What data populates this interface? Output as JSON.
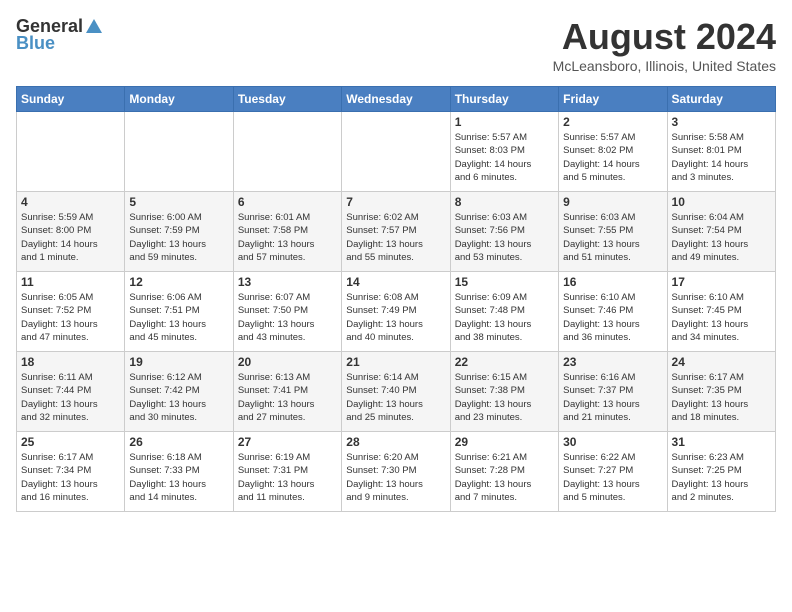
{
  "header": {
    "logo_general": "General",
    "logo_blue": "Blue",
    "month_title": "August 2024",
    "location": "McLeansboro, Illinois, United States"
  },
  "weekdays": [
    "Sunday",
    "Monday",
    "Tuesday",
    "Wednesday",
    "Thursday",
    "Friday",
    "Saturday"
  ],
  "weeks": [
    [
      {
        "day": "",
        "info": ""
      },
      {
        "day": "",
        "info": ""
      },
      {
        "day": "",
        "info": ""
      },
      {
        "day": "",
        "info": ""
      },
      {
        "day": "1",
        "info": "Sunrise: 5:57 AM\nSunset: 8:03 PM\nDaylight: 14 hours\nand 6 minutes."
      },
      {
        "day": "2",
        "info": "Sunrise: 5:57 AM\nSunset: 8:02 PM\nDaylight: 14 hours\nand 5 minutes."
      },
      {
        "day": "3",
        "info": "Sunrise: 5:58 AM\nSunset: 8:01 PM\nDaylight: 14 hours\nand 3 minutes."
      }
    ],
    [
      {
        "day": "4",
        "info": "Sunrise: 5:59 AM\nSunset: 8:00 PM\nDaylight: 14 hours\nand 1 minute."
      },
      {
        "day": "5",
        "info": "Sunrise: 6:00 AM\nSunset: 7:59 PM\nDaylight: 13 hours\nand 59 minutes."
      },
      {
        "day": "6",
        "info": "Sunrise: 6:01 AM\nSunset: 7:58 PM\nDaylight: 13 hours\nand 57 minutes."
      },
      {
        "day": "7",
        "info": "Sunrise: 6:02 AM\nSunset: 7:57 PM\nDaylight: 13 hours\nand 55 minutes."
      },
      {
        "day": "8",
        "info": "Sunrise: 6:03 AM\nSunset: 7:56 PM\nDaylight: 13 hours\nand 53 minutes."
      },
      {
        "day": "9",
        "info": "Sunrise: 6:03 AM\nSunset: 7:55 PM\nDaylight: 13 hours\nand 51 minutes."
      },
      {
        "day": "10",
        "info": "Sunrise: 6:04 AM\nSunset: 7:54 PM\nDaylight: 13 hours\nand 49 minutes."
      }
    ],
    [
      {
        "day": "11",
        "info": "Sunrise: 6:05 AM\nSunset: 7:52 PM\nDaylight: 13 hours\nand 47 minutes."
      },
      {
        "day": "12",
        "info": "Sunrise: 6:06 AM\nSunset: 7:51 PM\nDaylight: 13 hours\nand 45 minutes."
      },
      {
        "day": "13",
        "info": "Sunrise: 6:07 AM\nSunset: 7:50 PM\nDaylight: 13 hours\nand 43 minutes."
      },
      {
        "day": "14",
        "info": "Sunrise: 6:08 AM\nSunset: 7:49 PM\nDaylight: 13 hours\nand 40 minutes."
      },
      {
        "day": "15",
        "info": "Sunrise: 6:09 AM\nSunset: 7:48 PM\nDaylight: 13 hours\nand 38 minutes."
      },
      {
        "day": "16",
        "info": "Sunrise: 6:10 AM\nSunset: 7:46 PM\nDaylight: 13 hours\nand 36 minutes."
      },
      {
        "day": "17",
        "info": "Sunrise: 6:10 AM\nSunset: 7:45 PM\nDaylight: 13 hours\nand 34 minutes."
      }
    ],
    [
      {
        "day": "18",
        "info": "Sunrise: 6:11 AM\nSunset: 7:44 PM\nDaylight: 13 hours\nand 32 minutes."
      },
      {
        "day": "19",
        "info": "Sunrise: 6:12 AM\nSunset: 7:42 PM\nDaylight: 13 hours\nand 30 minutes."
      },
      {
        "day": "20",
        "info": "Sunrise: 6:13 AM\nSunset: 7:41 PM\nDaylight: 13 hours\nand 27 minutes."
      },
      {
        "day": "21",
        "info": "Sunrise: 6:14 AM\nSunset: 7:40 PM\nDaylight: 13 hours\nand 25 minutes."
      },
      {
        "day": "22",
        "info": "Sunrise: 6:15 AM\nSunset: 7:38 PM\nDaylight: 13 hours\nand 23 minutes."
      },
      {
        "day": "23",
        "info": "Sunrise: 6:16 AM\nSunset: 7:37 PM\nDaylight: 13 hours\nand 21 minutes."
      },
      {
        "day": "24",
        "info": "Sunrise: 6:17 AM\nSunset: 7:35 PM\nDaylight: 13 hours\nand 18 minutes."
      }
    ],
    [
      {
        "day": "25",
        "info": "Sunrise: 6:17 AM\nSunset: 7:34 PM\nDaylight: 13 hours\nand 16 minutes."
      },
      {
        "day": "26",
        "info": "Sunrise: 6:18 AM\nSunset: 7:33 PM\nDaylight: 13 hours\nand 14 minutes."
      },
      {
        "day": "27",
        "info": "Sunrise: 6:19 AM\nSunset: 7:31 PM\nDaylight: 13 hours\nand 11 minutes."
      },
      {
        "day": "28",
        "info": "Sunrise: 6:20 AM\nSunset: 7:30 PM\nDaylight: 13 hours\nand 9 minutes."
      },
      {
        "day": "29",
        "info": "Sunrise: 6:21 AM\nSunset: 7:28 PM\nDaylight: 13 hours\nand 7 minutes."
      },
      {
        "day": "30",
        "info": "Sunrise: 6:22 AM\nSunset: 7:27 PM\nDaylight: 13 hours\nand 5 minutes."
      },
      {
        "day": "31",
        "info": "Sunrise: 6:23 AM\nSunset: 7:25 PM\nDaylight: 13 hours\nand 2 minutes."
      }
    ]
  ]
}
